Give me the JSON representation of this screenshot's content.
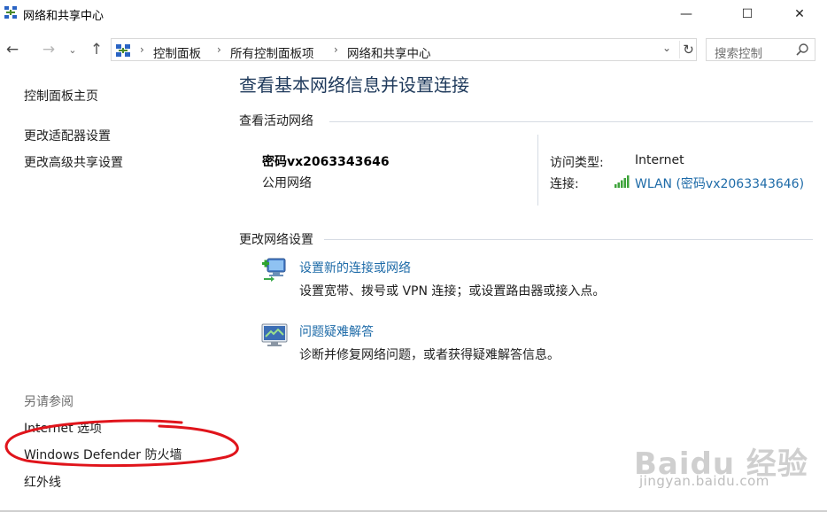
{
  "window": {
    "title": "网络和共享中心",
    "minimize_glyph": "—",
    "maximize_glyph": "☐",
    "close_glyph": "✕"
  },
  "nav": {
    "back_glyph": "←",
    "forward_glyph": "→",
    "recent_glyph": "⌄",
    "up_glyph": "↑",
    "breadcrumbs": [
      "控制面板",
      "所有控制面板项",
      "网络和共享中心"
    ],
    "separator": "›",
    "dropdown_glyph": "⌄",
    "refresh_glyph": "↻",
    "search_placeholder": "搜索控制",
    "icon_names": [
      "control-panel-icon",
      "search-icon",
      "refresh-icon"
    ]
  },
  "sidebar": {
    "home": "控制面板主页",
    "adapter_settings": "更改适配器设置",
    "advanced_sharing": "更改高级共享设置",
    "see_also_title": "另请参阅",
    "internet_options": "Internet 选项",
    "firewall": "Windows Defender 防火墙",
    "infrared": "红外线"
  },
  "main": {
    "title": "查看基本网络信息并设置连接",
    "active_networks_header": "查看活动网络",
    "network": {
      "name": "密码vx2063343646",
      "category": "公用网络",
      "access_type_label": "访问类型:",
      "access_type_value": "Internet",
      "connection_label": "连接:",
      "connection_value": "WLAN (密码vx2063343646)"
    },
    "change_settings_header": "更改网络设置",
    "tasks": [
      {
        "title": "设置新的连接或网络",
        "description": "设置宽带、拨号或 VPN 连接；或设置路由器或接入点。",
        "icon": "new-connection-icon"
      },
      {
        "title": "问题疑难解答",
        "description": "诊断并修复网络问题，或者获得疑难解答信息。",
        "icon": "troubleshoot-icon"
      }
    ]
  },
  "watermark": {
    "logo": "Baidu 经验",
    "url": "jingyan.baidu.com"
  },
  "colors": {
    "link": "#1e6ba8",
    "title": "#1e395b",
    "annotation_red": "#e0141b",
    "divider": "#d5dbe3"
  }
}
